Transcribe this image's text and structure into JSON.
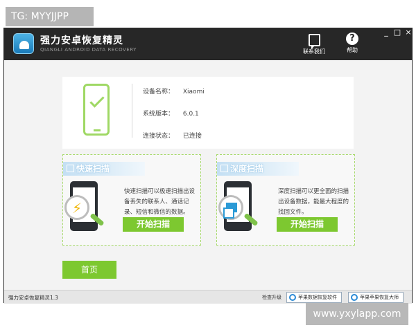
{
  "watermarks": {
    "top": "TG: MYYJJPP",
    "bottom": "www.yxylapp.com"
  },
  "app": {
    "title": "强力安卓恢复精灵",
    "subtitle": "QIANGLI ANDROID DATA RECOVERY"
  },
  "toolbar": {
    "contact_label": "联系我们",
    "help_label": "帮助",
    "help_glyph": "?"
  },
  "window_controls": {
    "minimize": "_",
    "maximize": "□",
    "close": "×"
  },
  "device": {
    "rows": [
      {
        "key": "设备名称：",
        "value": "Xiaomi"
      },
      {
        "key": "系统版本：",
        "value": "6.0.1"
      },
      {
        "key": "连接状态：",
        "value": "已连接"
      }
    ]
  },
  "quick_scan": {
    "title": "快速扫描",
    "description": "快速扫描可以极速扫描出设备丢失的联系人、通话记录、短信和微信的数据。",
    "button_label": "开始扫描",
    "icon": "lightning-icon",
    "accent": "#f0b400"
  },
  "deep_scan": {
    "title": "深度扫描",
    "description": "深度扫描可以更全面的扫描出设备数据，能最大程度的找回文件。",
    "button_label": "开始扫描",
    "icon": "layers-icon",
    "accent": "#2b9ad6"
  },
  "home_button": "首页",
  "statusbar": {
    "version": "强力安卓恢复精灵1.3",
    "check_update": "检查升级",
    "btn1": "苹果数据恢复软件",
    "btn2": "苹果苹果恢复大师"
  },
  "colors": {
    "titlebar": "#272727",
    "green": "#7dc830",
    "check_green": "#9fd864"
  }
}
